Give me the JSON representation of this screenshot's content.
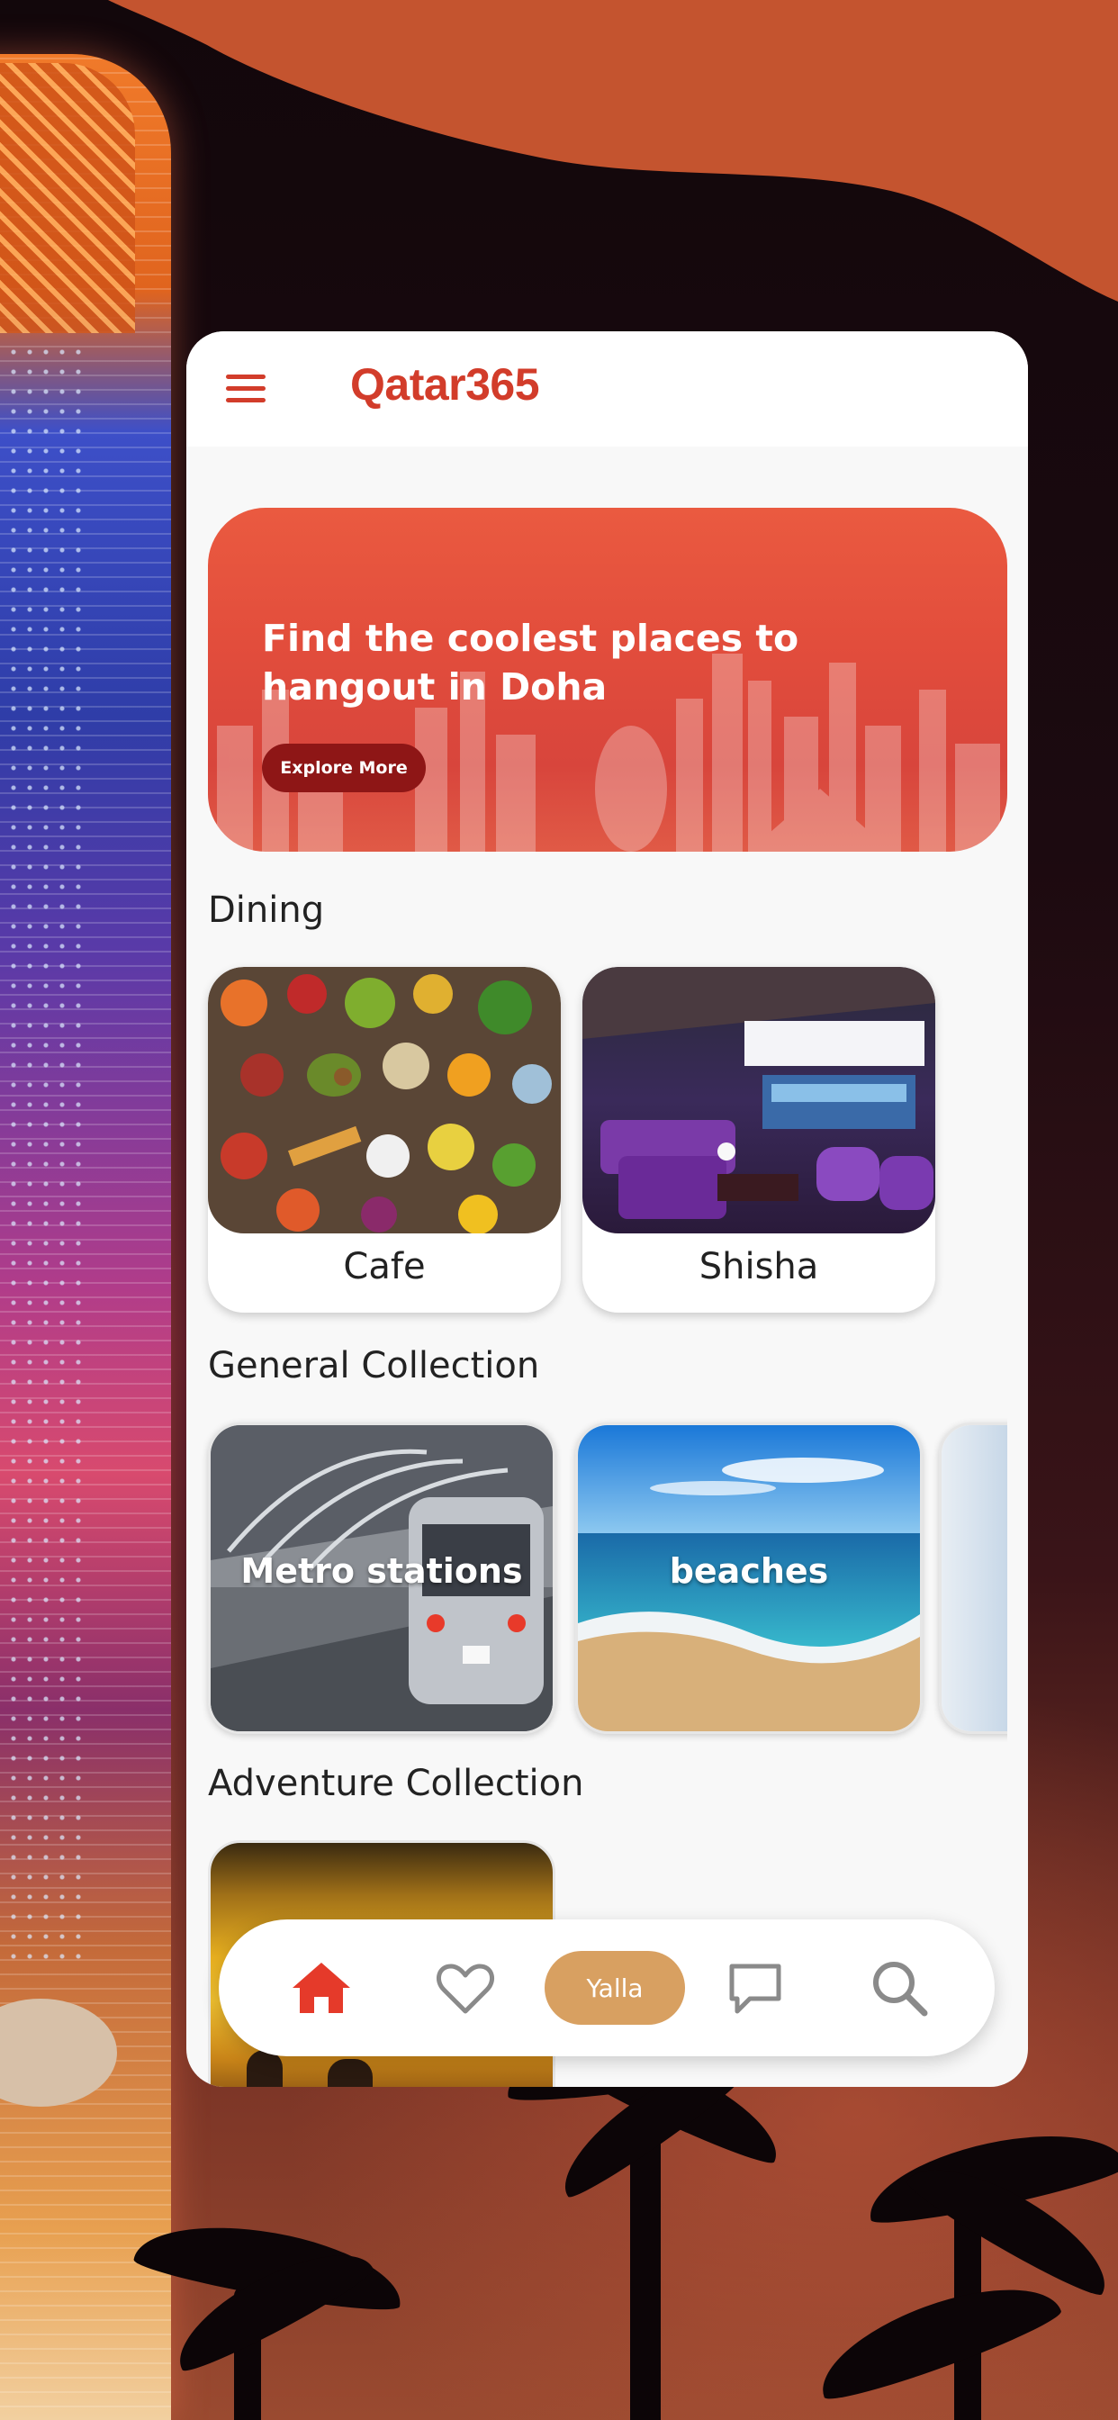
{
  "app": {
    "title": "Qatar365"
  },
  "hero": {
    "title": "Find the coolest places to hangout in Doha",
    "button_label": "Explore More"
  },
  "sections": {
    "dining": {
      "title": "Dining",
      "items": [
        {
          "label": "Cafe"
        },
        {
          "label": "Shisha"
        }
      ]
    },
    "general": {
      "title": "General Collection",
      "items": [
        {
          "label": "Metro stations"
        },
        {
          "label": "beaches"
        }
      ]
    },
    "adventure": {
      "title": "Adventure Collection"
    }
  },
  "nav": {
    "items": [
      {
        "icon": "home-icon"
      },
      {
        "icon": "heart-icon"
      },
      {
        "label": "Yalla"
      },
      {
        "icon": "chat-icon"
      },
      {
        "icon": "search-icon"
      }
    ],
    "active_color": "#e53a2a",
    "inactive_color": "#8a8a8a"
  },
  "colors": {
    "brand": "#d23c2a",
    "hero": "#e24d3c",
    "hero_button": "#8e1616",
    "yalla": "#d8a061"
  }
}
